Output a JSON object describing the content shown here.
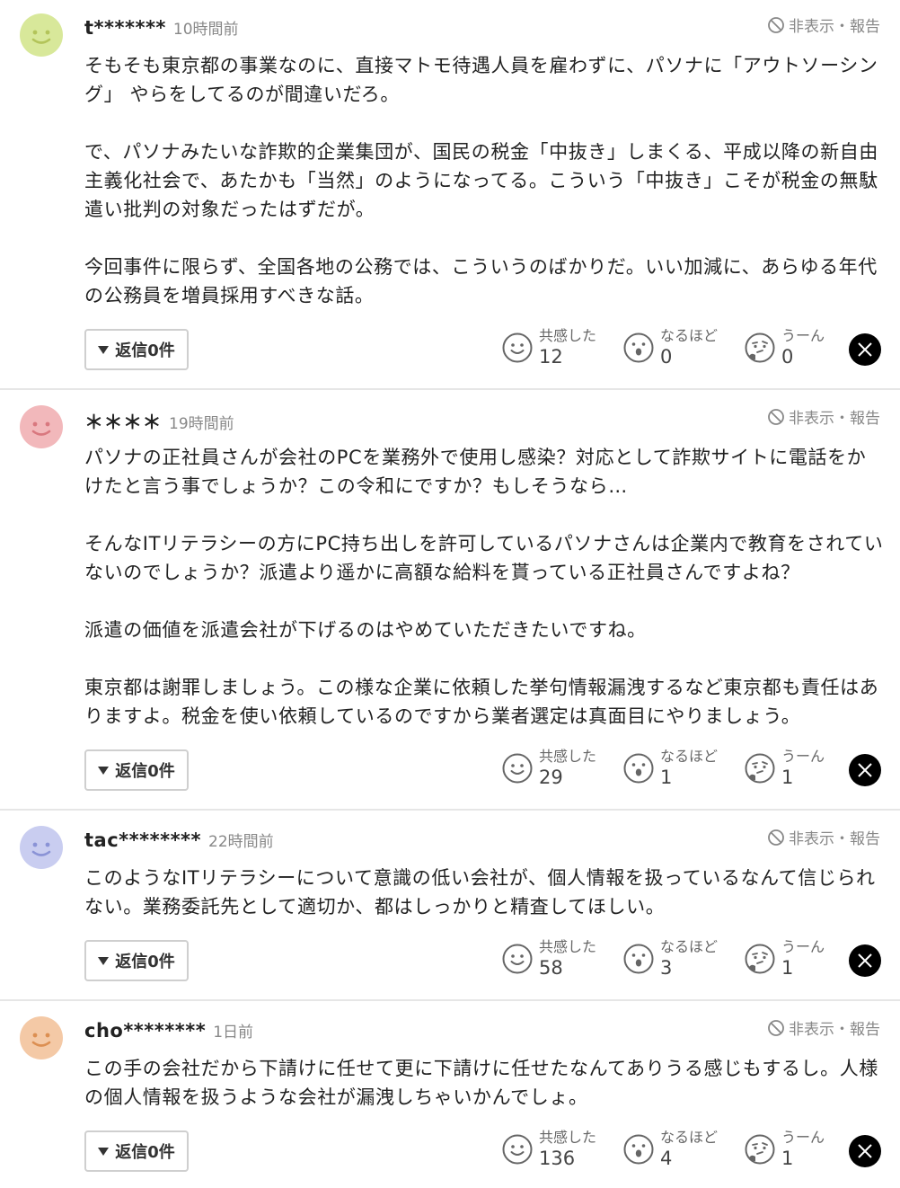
{
  "hide_report_label": "非表示・報告",
  "comments": [
    {
      "user": "t*******",
      "time": "10時間前",
      "paragraphs": [
        "そもそも東京都の事業なのに、直接マトモ待遇人員を雇わずに、パソナに「アウトソーシング」 やらをしてるのが間違いだろ。",
        "で、パソナみたいな詐欺的企業集団が、国民の税金「中抜き」しまくる、平成以降の新自由主義化社会で、あたかも「当然」のようになってる。こういう「中抜き」こそが税金の無駄遣い批判の対象だったはずだが。",
        "今回事件に限らず、全国各地の公務では、こういうのばかりだ。いい加減に、あらゆる年代の公務員を増員採用すべきな話。"
      ],
      "reply_label": "返信0件",
      "reactions": [
        {
          "label": "共感した",
          "count": "12"
        },
        {
          "label": "なるほど",
          "count": "0"
        },
        {
          "label": "うーん",
          "count": "0"
        }
      ]
    },
    {
      "user": "＊＊＊＊",
      "time": "19時間前",
      "paragraphs": [
        "パソナの正社員さんが会社のPCを業務外で使用し感染？対応として詐欺サイトに電話をかけたと言う事でしょうか？この令和にですか？もしそうなら…",
        "そんなITリテラシーの方にPC持ち出しを許可しているパソナさんは企業内で教育をされていないのでしょうか？派遣より遥かに高額な給料を貰っている正社員さんですよね？",
        "派遣の価値を派遣会社が下げるのはやめていただきたいですね。",
        "東京都は謝罪しましょう。この様な企業に依頼した挙句情報漏洩するなど東京都も責任はありますよ。税金を使い依頼しているのですから業者選定は真面目にやりましょう。"
      ],
      "reply_label": "返信0件",
      "reactions": [
        {
          "label": "共感した",
          "count": "29"
        },
        {
          "label": "なるほど",
          "count": "1"
        },
        {
          "label": "うーん",
          "count": "1"
        }
      ]
    },
    {
      "user": "tac********",
      "time": "22時間前",
      "paragraphs": [
        "このようなITリテラシーについて意識の低い会社が、個人情報を扱っているなんて信じられない。業務委託先として適切か、都はしっかりと精査してほしい。"
      ],
      "reply_label": "返信0件",
      "reactions": [
        {
          "label": "共感した",
          "count": "58"
        },
        {
          "label": "なるほど",
          "count": "3"
        },
        {
          "label": "うーん",
          "count": "1"
        }
      ]
    },
    {
      "user": "cho********",
      "time": "1日前",
      "paragraphs": [
        "この手の会社だから下請けに任せて更に下請けに任せたなんてありうる感じもするし。人様の個人情報を扱うような会社が漏洩しちゃいかんでしょ。"
      ],
      "reply_label": "返信0件",
      "reactions": [
        {
          "label": "共感した",
          "count": "136"
        },
        {
          "label": "なるほど",
          "count": "4"
        },
        {
          "label": "うーん",
          "count": "1"
        }
      ]
    }
  ],
  "colors": {
    "avatar_green": "#d8e89a",
    "avatar_pink": "#f2b8bb",
    "avatar_lavender": "#c9cdf0",
    "avatar_peach": "#f4c9a6"
  },
  "icons": [
    "smile-icon",
    "surprised-icon",
    "thinking-icon",
    "x-logo-icon",
    "block-icon"
  ]
}
